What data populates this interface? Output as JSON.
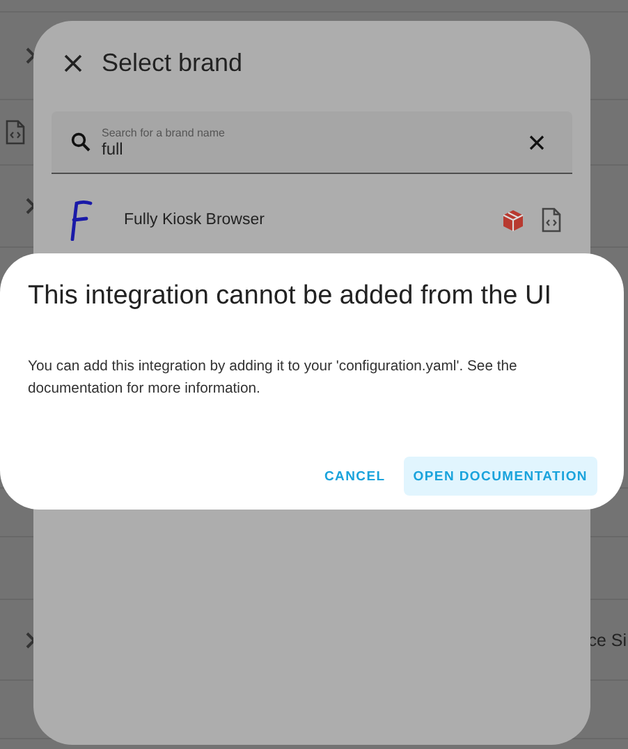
{
  "background": {
    "texts": [
      "ce Si"
    ]
  },
  "brand_dialog": {
    "title": "Select brand",
    "search": {
      "label": "Search for a brand name",
      "value": "full"
    },
    "results": [
      {
        "name": "Fully Kiosk Browser"
      }
    ]
  },
  "alert": {
    "title": "This integration cannot be added from the UI",
    "message": "You can add this integration by adding it to your 'configuration.yaml'. See the documentation for more information.",
    "buttons": [
      {
        "label": "CANCEL",
        "kind": "text"
      },
      {
        "label": "OPEN DOCUMENTATION",
        "kind": "tonal"
      }
    ]
  }
}
